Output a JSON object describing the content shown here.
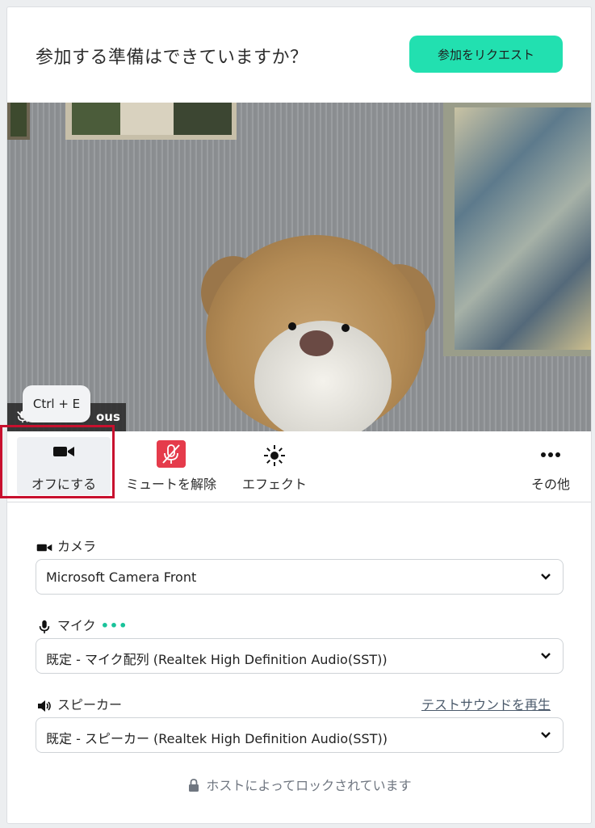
{
  "header": {
    "title": "参加する準備はできていますか？",
    "join_button": "参加をリクエスト"
  },
  "preview": {
    "participant_name_suffix": "ous",
    "tooltip": "Ctrl + E"
  },
  "toolbar": {
    "camera_label": "オフにする",
    "unmute_label": "ミュートを解除",
    "effects_label": "エフェクト",
    "more_label": "その他"
  },
  "camera": {
    "label": "カメラ",
    "selected": "Microsoft Camera Front"
  },
  "mic": {
    "label": "マイク",
    "activity": "•••",
    "selected": "既定 - マイク配列 (Realtek High Definition Audio(SST))"
  },
  "speaker": {
    "label": "スピーカー",
    "test_link": "テストサウンドを再生",
    "selected": "既定 - スピーカー (Realtek High Definition Audio(SST))"
  },
  "footer": {
    "lock_note": "ホストによってロックされています"
  },
  "colors": {
    "accent": "#22e0b0",
    "mute_red": "#e53b4b",
    "highlight": "#c8102e"
  }
}
